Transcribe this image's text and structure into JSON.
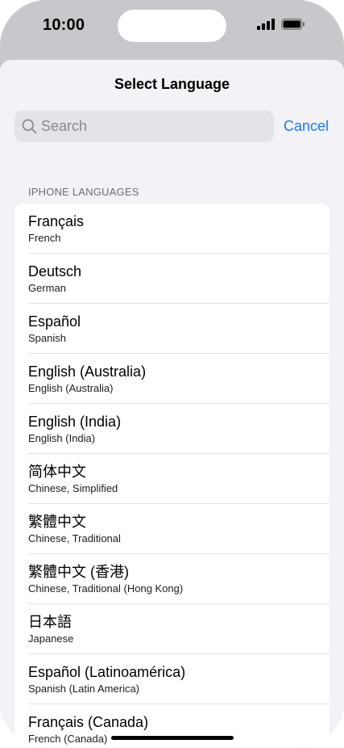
{
  "status_bar": {
    "time": "10:00",
    "icons": [
      "signal-icon",
      "battery-icon"
    ]
  },
  "sheet": {
    "title": "Select Language"
  },
  "search": {
    "placeholder": "Search",
    "value": ""
  },
  "cancel_label": "Cancel",
  "section": {
    "header": "IPHONE LANGUAGES"
  },
  "languages": [
    {
      "native": "Français",
      "english": "French"
    },
    {
      "native": "Deutsch",
      "english": "German"
    },
    {
      "native": "Español",
      "english": "Spanish"
    },
    {
      "native": "English (Australia)",
      "english": "English (Australia)"
    },
    {
      "native": "English (India)",
      "english": "English (India)"
    },
    {
      "native": "简体中文",
      "english": "Chinese, Simplified"
    },
    {
      "native": "繁體中文",
      "english": "Chinese, Traditional"
    },
    {
      "native": "繁體中文 (香港)",
      "english": "Chinese, Traditional (Hong Kong)"
    },
    {
      "native": "日本語",
      "english": "Japanese"
    },
    {
      "native": "Español (Latinoamérica)",
      "english": "Spanish (Latin America)"
    },
    {
      "native": "Français (Canada)",
      "english": "French (Canada)"
    }
  ],
  "colors": {
    "accent": "#1e7be0",
    "sheet_background": "#f2f2f7",
    "backdrop": "#c7c7cc"
  }
}
